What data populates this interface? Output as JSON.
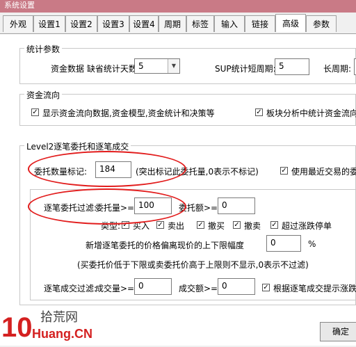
{
  "window": {
    "title": "系统设置"
  },
  "tabs": [
    "外观",
    "设置1",
    "设置2",
    "设置3",
    "设置4",
    "周期",
    "标签",
    "输入",
    "链接",
    "高级",
    "参数"
  ],
  "stats": {
    "legend": "统计参数",
    "missing_label": "资金数据 缺省统计天数:",
    "missing_value": "5",
    "sup_label": "SUP统计短周期:",
    "sup_value": "5",
    "long_label": "长周期:"
  },
  "fund": {
    "legend": "资金流向",
    "opt1": "显示资金流向数据,资金模型,资金统计和决策等",
    "opt2": "板块分析中统计资金流向等"
  },
  "level2": {
    "legend": "Level2逐笔委托和逐笔成交",
    "order_label": "委托数量标记:",
    "order_value": "184",
    "order_hint": "(突出标记此委托量,0表示不标记)",
    "recent_label": "使用最近交易的委托",
    "filter_label": "逐笔委托过滤:",
    "vol_label": "委托量>=",
    "vol_value": "100",
    "amt_label": "委托额>=",
    "amt_value": "0",
    "type_label": "类型:",
    "types": [
      "买入",
      "卖出",
      "撤买",
      "撤卖",
      "超过涨跌停单"
    ],
    "deviation_label": "新增逐笔委托的价格偏离现价的上下限幅度",
    "deviation_value": "0",
    "deviation_unit": "%",
    "note": "(买委托价低于下限或卖委托价高于上限则不显示,0表示不过滤)",
    "trade_label": "逐笔成交过滤:",
    "tvol_label": "成交量>=",
    "tvol_value": "0",
    "tamt_label": "成交额>=",
    "tamt_value": "0",
    "trade_opt": "根据逐笔成交提示涨跌停"
  },
  "buttons": {
    "ok": "确定"
  },
  "watermark": {
    "number": "10",
    "cn": "拾荒网",
    "url": "Huang.CN"
  }
}
